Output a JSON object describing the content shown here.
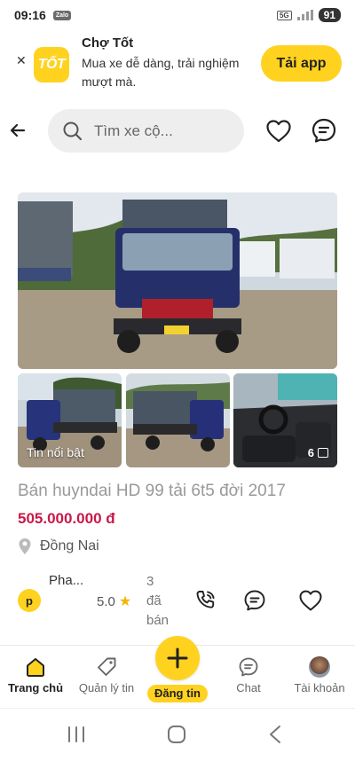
{
  "status_bar": {
    "time": "09:16",
    "notification": "Zalo",
    "network": "5G",
    "battery": "91"
  },
  "banner": {
    "app_name": "Chợ Tốt",
    "logo_text": "TỐT",
    "description": "Mua xe dễ dàng, trải nghiệm mượt mà.",
    "cta_label": "Tải app"
  },
  "search": {
    "placeholder": "Tìm xe cộ..."
  },
  "gallery": {
    "badge_label": "Tin nổi bật",
    "more_count": "6"
  },
  "listing": {
    "title": "Bán huyndai HD 99 tải 6t5 đời 2017",
    "price": "505.000.000 đ",
    "location": "Đồng Nai"
  },
  "seller": {
    "avatar_initial": "p",
    "name": "Pha...",
    "rating": "5.0",
    "sold_count": "3",
    "sold_label_1": "đã",
    "sold_label_2": "bán"
  },
  "bottom_nav": {
    "home": "Trang chủ",
    "manage": "Quản lý tin",
    "post": "Đăng tin",
    "chat": "Chat",
    "account": "Tài khoản"
  },
  "colors": {
    "brand_yellow": "#ffd21f",
    "price_red": "#c9184a"
  }
}
